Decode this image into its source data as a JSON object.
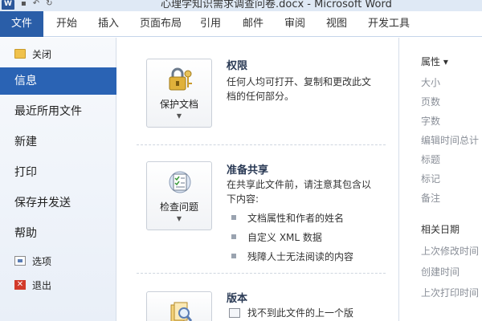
{
  "window": {
    "title": "心理学知识需求调查问卷.docx - Microsoft Word"
  },
  "ribbon": {
    "tabs": [
      {
        "label": "文件"
      },
      {
        "label": "开始"
      },
      {
        "label": "插入"
      },
      {
        "label": "页面布局"
      },
      {
        "label": "引用"
      },
      {
        "label": "邮件"
      },
      {
        "label": "审阅"
      },
      {
        "label": "视图"
      },
      {
        "label": "开发工具"
      }
    ]
  },
  "nav": {
    "items": [
      {
        "label": "关闭",
        "icon": "folder-icon"
      },
      {
        "label": "信息",
        "active": true
      },
      {
        "label": "最近所用文件"
      },
      {
        "label": "新建"
      },
      {
        "label": "打印"
      },
      {
        "label": "保存并发送"
      },
      {
        "label": "帮助"
      },
      {
        "label": "选项",
        "icon": "options-icon"
      },
      {
        "label": "退出",
        "icon": "exit-icon"
      }
    ]
  },
  "main": {
    "permissions": {
      "button_label": "保护文档",
      "title": "权限",
      "description": "任何人均可打开、复制和更改此文档的任何部分。",
      "icon": "lock-key-icon"
    },
    "sharing": {
      "button_label": "检查问题",
      "title": "准备共享",
      "description": "在共享此文件前，请注意其包含以下内容:",
      "items": [
        "文档属性和作者的姓名",
        "自定义 XML 数据",
        "残障人士无法阅读的内容"
      ],
      "icon": "checklist-icon"
    },
    "versions": {
      "title": "版本",
      "description": "找不到此文件的上一个版",
      "icon": "search-document-icon"
    }
  },
  "properties": {
    "header": "属性 ▾",
    "items": [
      "大小",
      "页数",
      "字数",
      "编辑时间总计",
      "标题",
      "标记",
      "备注"
    ],
    "related_dates_header": "相关日期",
    "related_dates": [
      "上次修改时间",
      "创建时间",
      "上次打印时间"
    ]
  },
  "colors": {
    "accent": "#2a5ea8",
    "nav_active": "#2a63b4"
  }
}
